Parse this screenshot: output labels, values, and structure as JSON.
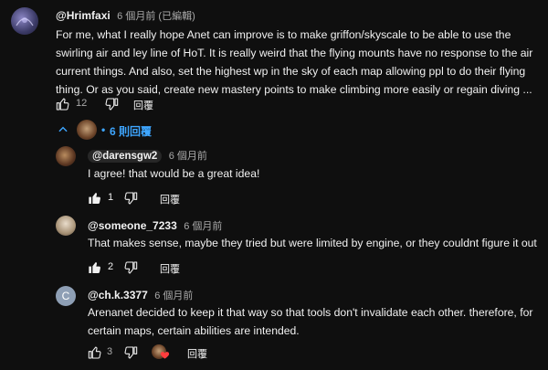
{
  "main_comment": {
    "author": "@Hrimfaxi",
    "time": "6 個月前 (已編輯)",
    "lines": [
      "For me, what I really hope Anet can improve is to make griffon/skyscale to be able to use the",
      "swirling air and ley line of HoT. It is really weird that the flying mounts have no response to the air",
      "current things. And also, set the highest wp in the sky of each map allowing ppl to do their flying",
      "thing. Or as you said, create new mastery points to make climbing more easily or regain diving ..."
    ],
    "likes": "12",
    "reply_label": "回覆"
  },
  "replies_toggle": {
    "label": "6 則回覆"
  },
  "replies": [
    {
      "author": "@darensgw2",
      "time": "6 個月前",
      "text": "I agree! that would be a great idea!",
      "likes": "1",
      "reply_label": "回覆"
    },
    {
      "author": "@someone_7233",
      "time": "6 個月前",
      "text": "That makes sense, maybe they tried but were limited by engine, or they couldnt figure it out",
      "likes": "2",
      "reply_label": "回覆"
    },
    {
      "author": "@ch.k.3377",
      "time": "6 個月前",
      "avatar_letter": "C",
      "lines": [
        "Arenanet decided to keep it that way so that tools don't invalidate each other. therefore, for",
        "certain maps, certain abilities are intended."
      ],
      "likes": "3",
      "reply_label": "回覆"
    }
  ],
  "colors": {
    "background": "#0f0f0f",
    "link_blue": "#3ea6ff",
    "heart": "#ff3d3d"
  }
}
